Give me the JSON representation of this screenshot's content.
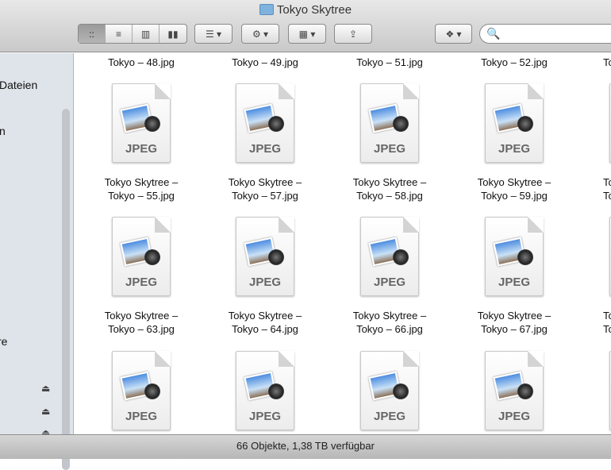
{
  "window": {
    "title": "Tokyo Skytree"
  },
  "toolbar": {
    "view_icons": "::",
    "view_list": "≡",
    "view_columns": "▥",
    "view_coverflow": "▮▮",
    "arrange": "☰ ▾",
    "action": "⚙ ▾",
    "arrange_grid": "▦ ▾",
    "share": "⇪",
    "dropbox": "❖ ▾",
    "search_placeholder": "🔍"
  },
  "sidebar": {
    "items": [
      "Dateien",
      "n",
      "re"
    ],
    "eject": "⏏"
  },
  "top_row": [
    "Tokyo – 48.jpg",
    "Tokyo – 49.jpg",
    "Tokyo – 51.jpg",
    "Tokyo – 52.jpg",
    "To"
  ],
  "rows": [
    [
      [
        "Tokyo Skytree –",
        "Tokyo – 55.jpg"
      ],
      [
        "Tokyo Skytree –",
        "Tokyo – 57.jpg"
      ],
      [
        "Tokyo Skytree –",
        "Tokyo – 58.jpg"
      ],
      [
        "Tokyo Skytree –",
        "Tokyo – 59.jpg"
      ],
      [
        "To",
        "To"
      ]
    ],
    [
      [
        "Tokyo Skytree –",
        "Tokyo – 63.jpg"
      ],
      [
        "Tokyo Skytree –",
        "Tokyo – 64.jpg"
      ],
      [
        "Tokyo Skytree –",
        "Tokyo – 66.jpg"
      ],
      [
        "Tokyo Skytree –",
        "Tokyo – 67.jpg"
      ],
      [
        "To",
        "To"
      ]
    ]
  ],
  "file_type_label": "JPEG",
  "status": "66 Objekte, 1,38 TB verfügbar"
}
